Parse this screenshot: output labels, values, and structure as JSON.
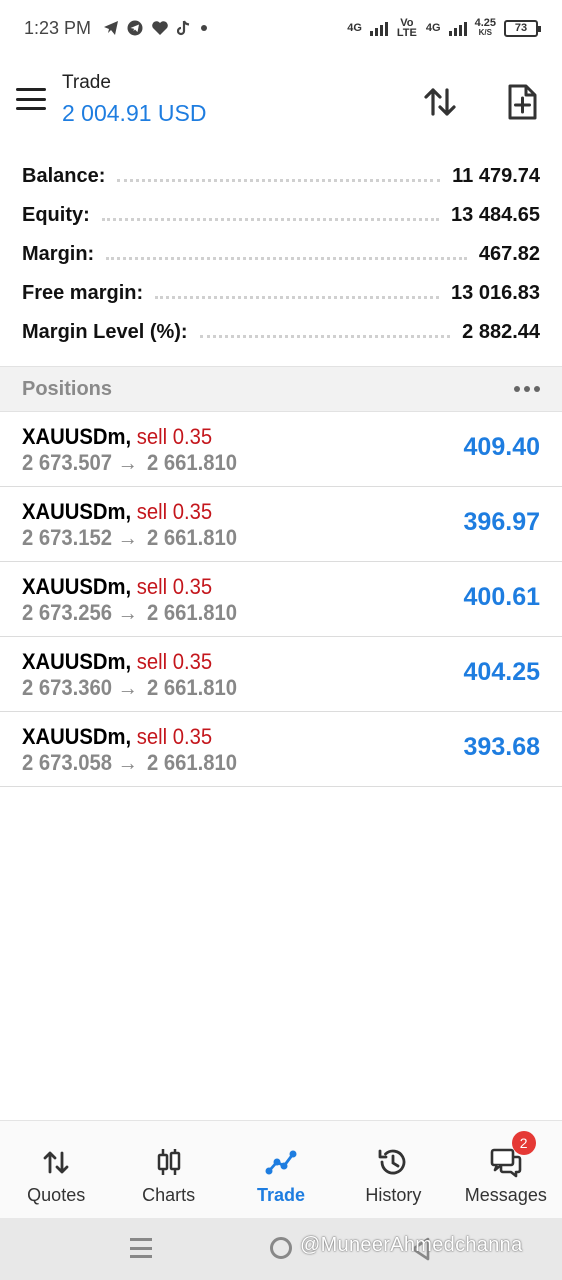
{
  "status_bar": {
    "time": "1:23 PM",
    "app_icons": [
      "telegram-icon",
      "telegram-icon",
      "heart-icon",
      "tiktok-icon",
      "dot-icon"
    ],
    "net1": "4G",
    "volte": "Vo LTE",
    "net2": "4G",
    "speed": "4.25",
    "speed_unit": "K/S",
    "battery": "73"
  },
  "header": {
    "title": "Trade",
    "subtitle": "2 004.91 USD"
  },
  "summary": [
    {
      "label": "Balance:",
      "value": "11 479.74"
    },
    {
      "label": "Equity:",
      "value": "13 484.65"
    },
    {
      "label": "Margin:",
      "value": "467.82"
    },
    {
      "label": "Free margin:",
      "value": "13 016.83"
    },
    {
      "label": "Margin Level (%):",
      "value": "2 882.44"
    }
  ],
  "positions_header": "Positions",
  "positions": [
    {
      "symbol": "XAUUSDm,",
      "side": "sell 0.35",
      "open": "2 673.507",
      "arrow": "→",
      "current": "2 661.810",
      "profit": "409.40"
    },
    {
      "symbol": "XAUUSDm,",
      "side": "sell 0.35",
      "open": "2 673.152",
      "arrow": "→",
      "current": "2 661.810",
      "profit": "396.97"
    },
    {
      "symbol": "XAUUSDm,",
      "side": "sell 0.35",
      "open": "2 673.256",
      "arrow": "→",
      "current": "2 661.810",
      "profit": "400.61"
    },
    {
      "symbol": "XAUUSDm,",
      "side": "sell 0.35",
      "open": "2 673.360",
      "arrow": "→",
      "current": "2 661.810",
      "profit": "404.25"
    },
    {
      "symbol": "XAUUSDm,",
      "side": "sell 0.35",
      "open": "2 673.058",
      "arrow": "→",
      "current": "2 661.810",
      "profit": "393.68"
    }
  ],
  "bottom_nav": [
    {
      "label": "Quotes",
      "icon": "quotes-icon",
      "active": false
    },
    {
      "label": "Charts",
      "icon": "charts-icon",
      "active": false
    },
    {
      "label": "Trade",
      "icon": "trade-icon",
      "active": true
    },
    {
      "label": "History",
      "icon": "history-icon",
      "active": false
    },
    {
      "label": "Messages",
      "icon": "messages-icon",
      "active": false,
      "badge": "2"
    }
  ],
  "watermark": "@MuneerAhmedchanna",
  "colors": {
    "accent": "#1e7de0",
    "sell": "#c4161c",
    "badge": "#e53935"
  }
}
